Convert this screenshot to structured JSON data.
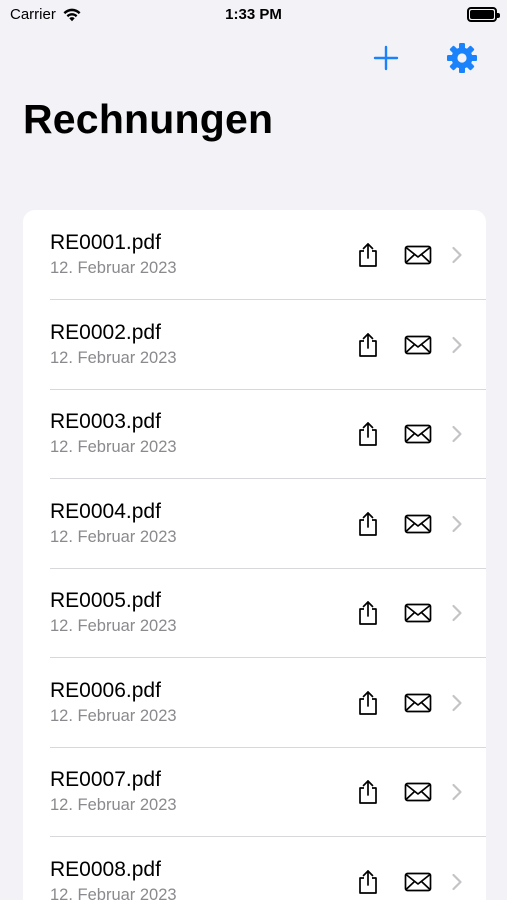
{
  "status_bar": {
    "carrier": "Carrier",
    "time": "1:33 PM",
    "wifi_icon": "wifi-icon",
    "battery_icon": "battery-icon"
  },
  "nav": {
    "title": "Rechnungen",
    "add_icon": "plus-icon",
    "settings_icon": "gear-icon",
    "accent_color": "#1a82fb"
  },
  "invoices": [
    {
      "name": "RE0001.pdf",
      "date": "12. Februar 2023"
    },
    {
      "name": "RE0002.pdf",
      "date": "12. Februar 2023"
    },
    {
      "name": "RE0003.pdf",
      "date": "12. Februar 2023"
    },
    {
      "name": "RE0004.pdf",
      "date": "12. Februar 2023"
    },
    {
      "name": "RE0005.pdf",
      "date": "12. Februar 2023"
    },
    {
      "name": "RE0006.pdf",
      "date": "12. Februar 2023"
    },
    {
      "name": "RE0007.pdf",
      "date": "12. Februar 2023"
    },
    {
      "name": "RE0008.pdf",
      "date": "12. Februar 2023"
    }
  ],
  "row_icons": {
    "share": "share-icon",
    "mail": "mail-icon",
    "chevron": "chevron-right-icon"
  }
}
